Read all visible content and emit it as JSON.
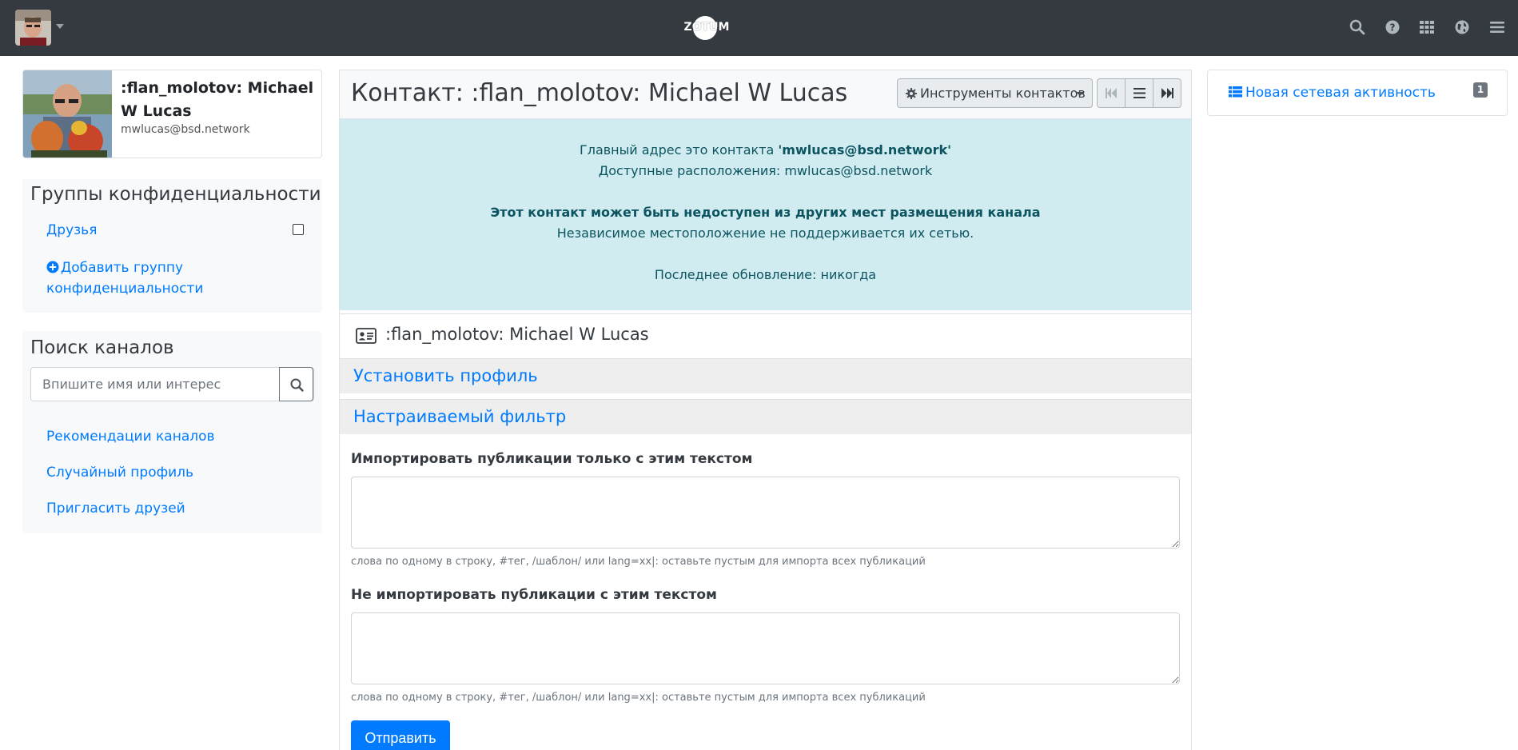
{
  "navbar": {
    "brand": "ZOTUM",
    "icons": [
      "search-icon",
      "help-icon",
      "apps-grid-icon",
      "globe-icon",
      "menu-icon"
    ]
  },
  "profile": {
    "name": ":flan_molotov: Michael W Lucas",
    "address": "mwlucas@bsd.network"
  },
  "privacy_groups": {
    "title": "Группы конфиденциальности",
    "items": [
      {
        "label": "Друзья"
      }
    ],
    "add_label": "Добавить группу конфиденциальности"
  },
  "channel_search": {
    "title": "Поиск каналов",
    "placeholder": "Впишите имя или интерес",
    "links": [
      "Рекомендации каналов",
      "Случайный профиль",
      "Пригласить друзей"
    ]
  },
  "main": {
    "title": "Контакт: :flan_molotov: Michael W Lucas",
    "tools_label": "Инструменты контактов",
    "alert": {
      "primary_prefix": "Главный адрес это контакта ",
      "primary_address": "'mwlucas@bsd.network'",
      "locations": "Доступные расположения: mwlucas@bsd.network",
      "warning": "Этот контакт может быть недоступен из других мест размещения канала",
      "nomadic": "Независимое местоположение не поддерживается их сетью.",
      "last_update": "Последнее обновление: никогда"
    },
    "vcard_name": ":flan_molotov: Michael W Lucas",
    "set_profile": "Установить профиль",
    "custom_filter": "Настраиваемый фильтр",
    "import_only_label": "Импортировать публикации только с этим текстом",
    "import_only_help": "слова по одному в строку, #тег, /шаблон/ или lang=xx|: оставьте пустым для импорта всех публикаций",
    "exclude_label": "Не импортировать публикации с этим текстом",
    "exclude_help": "слова по одному в строку, #тег, /шаблон/ или lang=xx|: оставьте пустым для импорта всех публикаций",
    "submit_label": "Отправить"
  },
  "right": {
    "activity_label": "Новая сетевая активность",
    "activity_count": "1"
  },
  "colors": {
    "navbar": "#343a40",
    "link": "#007bff",
    "alert_bg": "#d1ecf1",
    "alert_text": "#0c5460",
    "primary_button": "#007bff"
  }
}
